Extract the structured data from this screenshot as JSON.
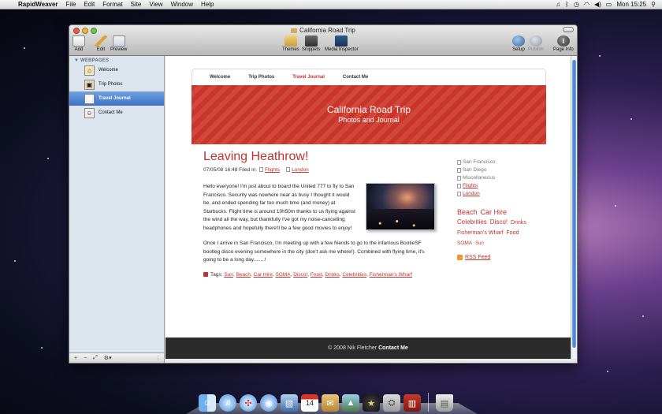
{
  "menubar": {
    "apple": "",
    "app_name": "RapidWeaver",
    "menus": [
      "File",
      "Edit",
      "Format",
      "Site",
      "View",
      "Window",
      "Help"
    ],
    "clock": "Mon 15:25"
  },
  "window": {
    "title": "California Road Trip",
    "toolbar": {
      "add": "Add",
      "edit": "Edit",
      "preview": "Preview",
      "themes": "Themes",
      "snippets": "Snippets",
      "media_inspector": "Media Inspector",
      "setup": "Setup",
      "publish": "Publish",
      "page_info": "Page Info"
    }
  },
  "sidebar": {
    "heading": "▼ WEBPAGES",
    "items": [
      {
        "label": "Welcome",
        "icon": "house-icon"
      },
      {
        "label": "Trip Photos",
        "icon": "photo-album-icon"
      },
      {
        "label": "Travel Journal",
        "icon": "journal-icon",
        "selected": true
      },
      {
        "label": "Contact Me",
        "icon": "contact-icon"
      }
    ],
    "footer": {
      "add": "+",
      "remove": "−",
      "edit": "⤢",
      "action": "⚙▾"
    }
  },
  "site": {
    "nav": [
      "Welcome",
      "Trip Photos",
      "Travel Journal",
      "Contact Me"
    ],
    "nav_active": "Travel Journal",
    "banner_title": "California Road Trip",
    "banner_subtitle": "Photos and Journal",
    "post": {
      "title": "Leaving Heathrow!",
      "meta_prefix": "07/05/08 16:48 Filed in:",
      "categories": [
        "Flights",
        "London"
      ],
      "paragraph1": "Hello everyone! I'm just about to board the United 777 to fly to San Francisco. Security was nowhere near as busy I thought it would be, and ended spending far too much time (and money) at Starbucks. Flight time is around 10h50m thanks to us flying against the wind all the way, but thankfully I've got my noise-cancelling headphones and hopefully there'll be a few good movies to enjoy!",
      "paragraph2": "Once I arrive in San Francisco, I'm meeting up with a few friends to go to the infamous BootieSF bootleg disco evening somewhere in the city (don't ask me where!). Combined with flying time, it's going to be a long day........!",
      "tags_label": "Tags:",
      "tags": [
        "Sun",
        "Beach",
        "Car Hire",
        "SOMA",
        "Disco!",
        "Food",
        "Drinks",
        "Celebrities",
        "Fisherman's Wharf"
      ]
    },
    "side_categories": [
      {
        "label": "San Francisco",
        "link": false
      },
      {
        "label": "San Diego",
        "link": false
      },
      {
        "label": "Miscellaneous",
        "link": false
      },
      {
        "label": "Flights",
        "link": true
      },
      {
        "label": "London",
        "link": true
      }
    ],
    "tag_cloud": [
      {
        "label": "Beach",
        "size": 9
      },
      {
        "label": "Car Hire",
        "size": 9
      },
      {
        "label": "Celebrities",
        "size": 8
      },
      {
        "label": "Disco!",
        "size": 8
      },
      {
        "label": "Drinks",
        "size": 7
      },
      {
        "label": "Fisherman's Wharf",
        "size": 7
      },
      {
        "label": "Food",
        "size": 7
      },
      {
        "label": "SOMA",
        "size": 6.5
      },
      {
        "label": "Sun",
        "size": 6
      }
    ],
    "rss": "RSS Feed",
    "footer_copy": "© 2008 Nik Fletcher",
    "footer_link": "Contact Me"
  },
  "dock": {
    "items": [
      "Finder",
      "iTunes",
      "Safari",
      "iChat",
      "Preview",
      "iCal",
      "Mail",
      "iPhoto",
      "RapidWeaver",
      "Disk Utility",
      "Photo Booth",
      "Trash"
    ]
  },
  "colors": {
    "accent": "#c0322b",
    "selection": "#3d72c5",
    "footer": "#2b2b2b"
  }
}
